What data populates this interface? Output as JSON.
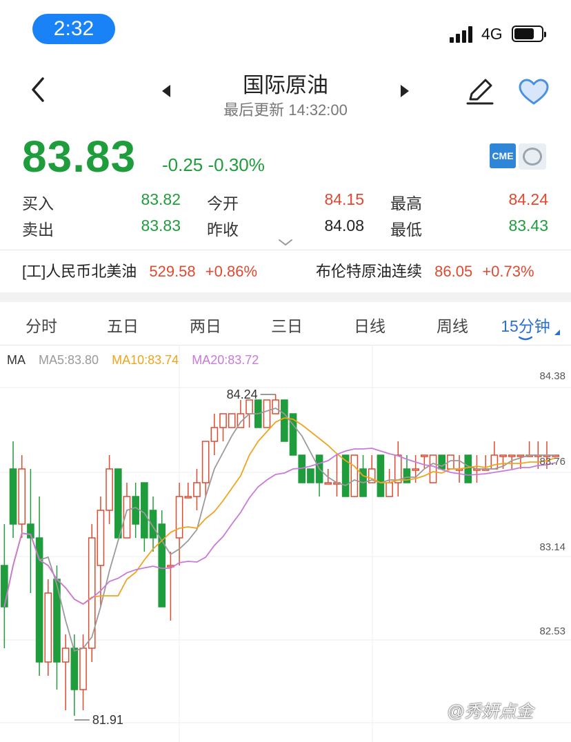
{
  "status": {
    "time": "2:32",
    "network": "4G"
  },
  "header": {
    "title": "国际原油",
    "subtitle": "最后更新 14:32:00"
  },
  "quote": {
    "price": "83.83",
    "change": "-0.25 -0.30%",
    "badge": "CME",
    "fields": [
      {
        "label": "买入",
        "value": "83.82",
        "color": "green"
      },
      {
        "label": "今开",
        "value": "84.15",
        "color": "red"
      },
      {
        "label": "最高",
        "value": "84.24",
        "color": "red"
      },
      {
        "label": "卖出",
        "value": "83.83",
        "color": "green"
      },
      {
        "label": "昨收",
        "value": "84.08",
        "color": "dark"
      },
      {
        "label": "最低",
        "value": "83.43",
        "color": "green"
      }
    ]
  },
  "related": [
    {
      "name": "[工]人民币北美油",
      "price": "529.58",
      "change": "+0.86%"
    },
    {
      "name": "布伦特原油连续",
      "price": "86.05",
      "change": "+0.73%"
    }
  ],
  "tabs": [
    "分时",
    "五日",
    "两日",
    "三日",
    "日线",
    "周线",
    "15分钟"
  ],
  "active_tab": 6,
  "ma_legend": {
    "label": "MA",
    "ma5": "MA5:83.80",
    "ma10": "MA10:83.74",
    "ma20": "MA20:83.72"
  },
  "colors": {
    "up": "#e0492f",
    "down": "#1f9d3c",
    "ma5": "#9a9a9a",
    "ma10": "#f0a41e",
    "ma20": "#c77ad9",
    "accent": "#2b6fd3"
  },
  "watermark": "@秀妍点金",
  "chart_data": {
    "type": "candlestick",
    "y_axis_ticks": [
      "84.38",
      "83.76",
      "83.14",
      "82.53"
    ],
    "ylim": [
      81.8,
      84.5
    ],
    "annotations": {
      "high": "84.24",
      "low": "81.91"
    },
    "candles": [
      [
        83.0,
        83.3,
        82.4,
        82.7
      ],
      [
        83.7,
        83.9,
        83.2,
        83.3
      ],
      [
        83.3,
        83.8,
        83.2,
        83.7
      ],
      [
        83.3,
        83.7,
        82.8,
        83.2
      ],
      [
        83.2,
        83.5,
        82.2,
        82.3
      ],
      [
        82.3,
        82.9,
        82.2,
        82.8
      ],
      [
        82.9,
        83.0,
        82.1,
        82.3
      ],
      [
        82.3,
        82.5,
        81.95,
        82.4
      ],
      [
        82.4,
        82.5,
        81.91,
        82.1
      ],
      [
        82.1,
        82.5,
        81.95,
        82.4
      ],
      [
        82.4,
        83.3,
        82.3,
        83.2
      ],
      [
        83.0,
        83.5,
        82.7,
        83.4
      ],
      [
        83.4,
        83.8,
        83.3,
        83.7
      ],
      [
        83.7,
        83.7,
        83.2,
        83.2
      ],
      [
        83.2,
        83.6,
        83.2,
        83.5
      ],
      [
        83.5,
        83.6,
        83.2,
        83.3
      ],
      [
        83.6,
        83.6,
        83.1,
        83.2
      ],
      [
        83.4,
        83.5,
        83.1,
        83.2
      ],
      [
        83.3,
        83.4,
        82.8,
        82.7
      ],
      [
        83.0,
        83.1,
        82.6,
        83.0
      ],
      [
        83.2,
        83.6,
        83.0,
        83.5
      ],
      [
        83.5,
        83.6,
        83.5,
        83.5
      ],
      [
        83.5,
        83.7,
        83.4,
        83.6
      ],
      [
        83.6,
        83.9,
        83.5,
        83.9
      ],
      [
        83.9,
        84.1,
        83.8,
        84.0
      ],
      [
        84.0,
        84.1,
        83.9,
        84.1
      ],
      [
        84.0,
        84.1,
        84.0,
        84.1
      ],
      [
        84.0,
        84.2,
        84.0,
        84.1
      ],
      [
        84.1,
        84.2,
        84.0,
        84.2
      ],
      [
        84.2,
        84.2,
        84.0,
        84.0
      ],
      [
        84.0,
        84.2,
        84.0,
        84.2
      ],
      [
        84.1,
        84.24,
        84.1,
        84.2
      ],
      [
        84.2,
        84.2,
        83.9,
        83.9
      ],
      [
        84.1,
        84.1,
        83.9,
        83.8
      ],
      [
        83.8,
        83.8,
        83.6,
        83.6
      ],
      [
        83.7,
        83.7,
        83.6,
        83.6
      ],
      [
        83.8,
        83.8,
        83.5,
        83.6
      ],
      [
        83.6,
        83.7,
        83.6,
        83.6
      ],
      [
        83.6,
        83.8,
        83.5,
        83.6
      ],
      [
        83.8,
        83.8,
        83.5,
        83.5
      ],
      [
        83.5,
        83.8,
        83.5,
        83.8
      ],
      [
        83.7,
        83.8,
        83.6,
        83.5
      ],
      [
        83.6,
        83.8,
        83.6,
        83.7
      ],
      [
        83.8,
        83.8,
        83.5,
        83.5
      ],
      [
        83.5,
        83.7,
        83.5,
        83.6
      ],
      [
        83.6,
        83.9,
        83.5,
        83.8
      ],
      [
        83.7,
        83.8,
        83.6,
        83.6
      ],
      [
        83.7,
        83.8,
        83.6,
        83.7
      ],
      [
        83.8,
        83.8,
        83.7,
        83.8
      ],
      [
        83.6,
        83.8,
        83.6,
        83.8
      ],
      [
        83.8,
        83.8,
        83.7,
        83.7
      ],
      [
        83.7,
        83.8,
        83.7,
        83.8
      ],
      [
        83.7,
        83.8,
        83.6,
        83.7
      ],
      [
        83.8,
        83.8,
        83.6,
        83.6
      ],
      [
        83.7,
        83.8,
        83.6,
        83.7
      ],
      [
        83.7,
        83.8,
        83.7,
        83.7
      ],
      [
        83.7,
        83.9,
        83.7,
        83.8
      ],
      [
        83.8,
        83.8,
        83.7,
        83.8
      ],
      [
        83.8,
        83.8,
        83.7,
        83.8
      ],
      [
        83.8,
        83.8,
        83.7,
        83.8
      ],
      [
        83.8,
        83.9,
        83.8,
        83.8
      ],
      [
        83.8,
        83.9,
        83.7,
        83.8
      ],
      [
        83.8,
        83.9,
        83.7,
        83.8
      ],
      [
        83.8,
        83.8,
        83.8,
        83.8
      ]
    ]
  }
}
